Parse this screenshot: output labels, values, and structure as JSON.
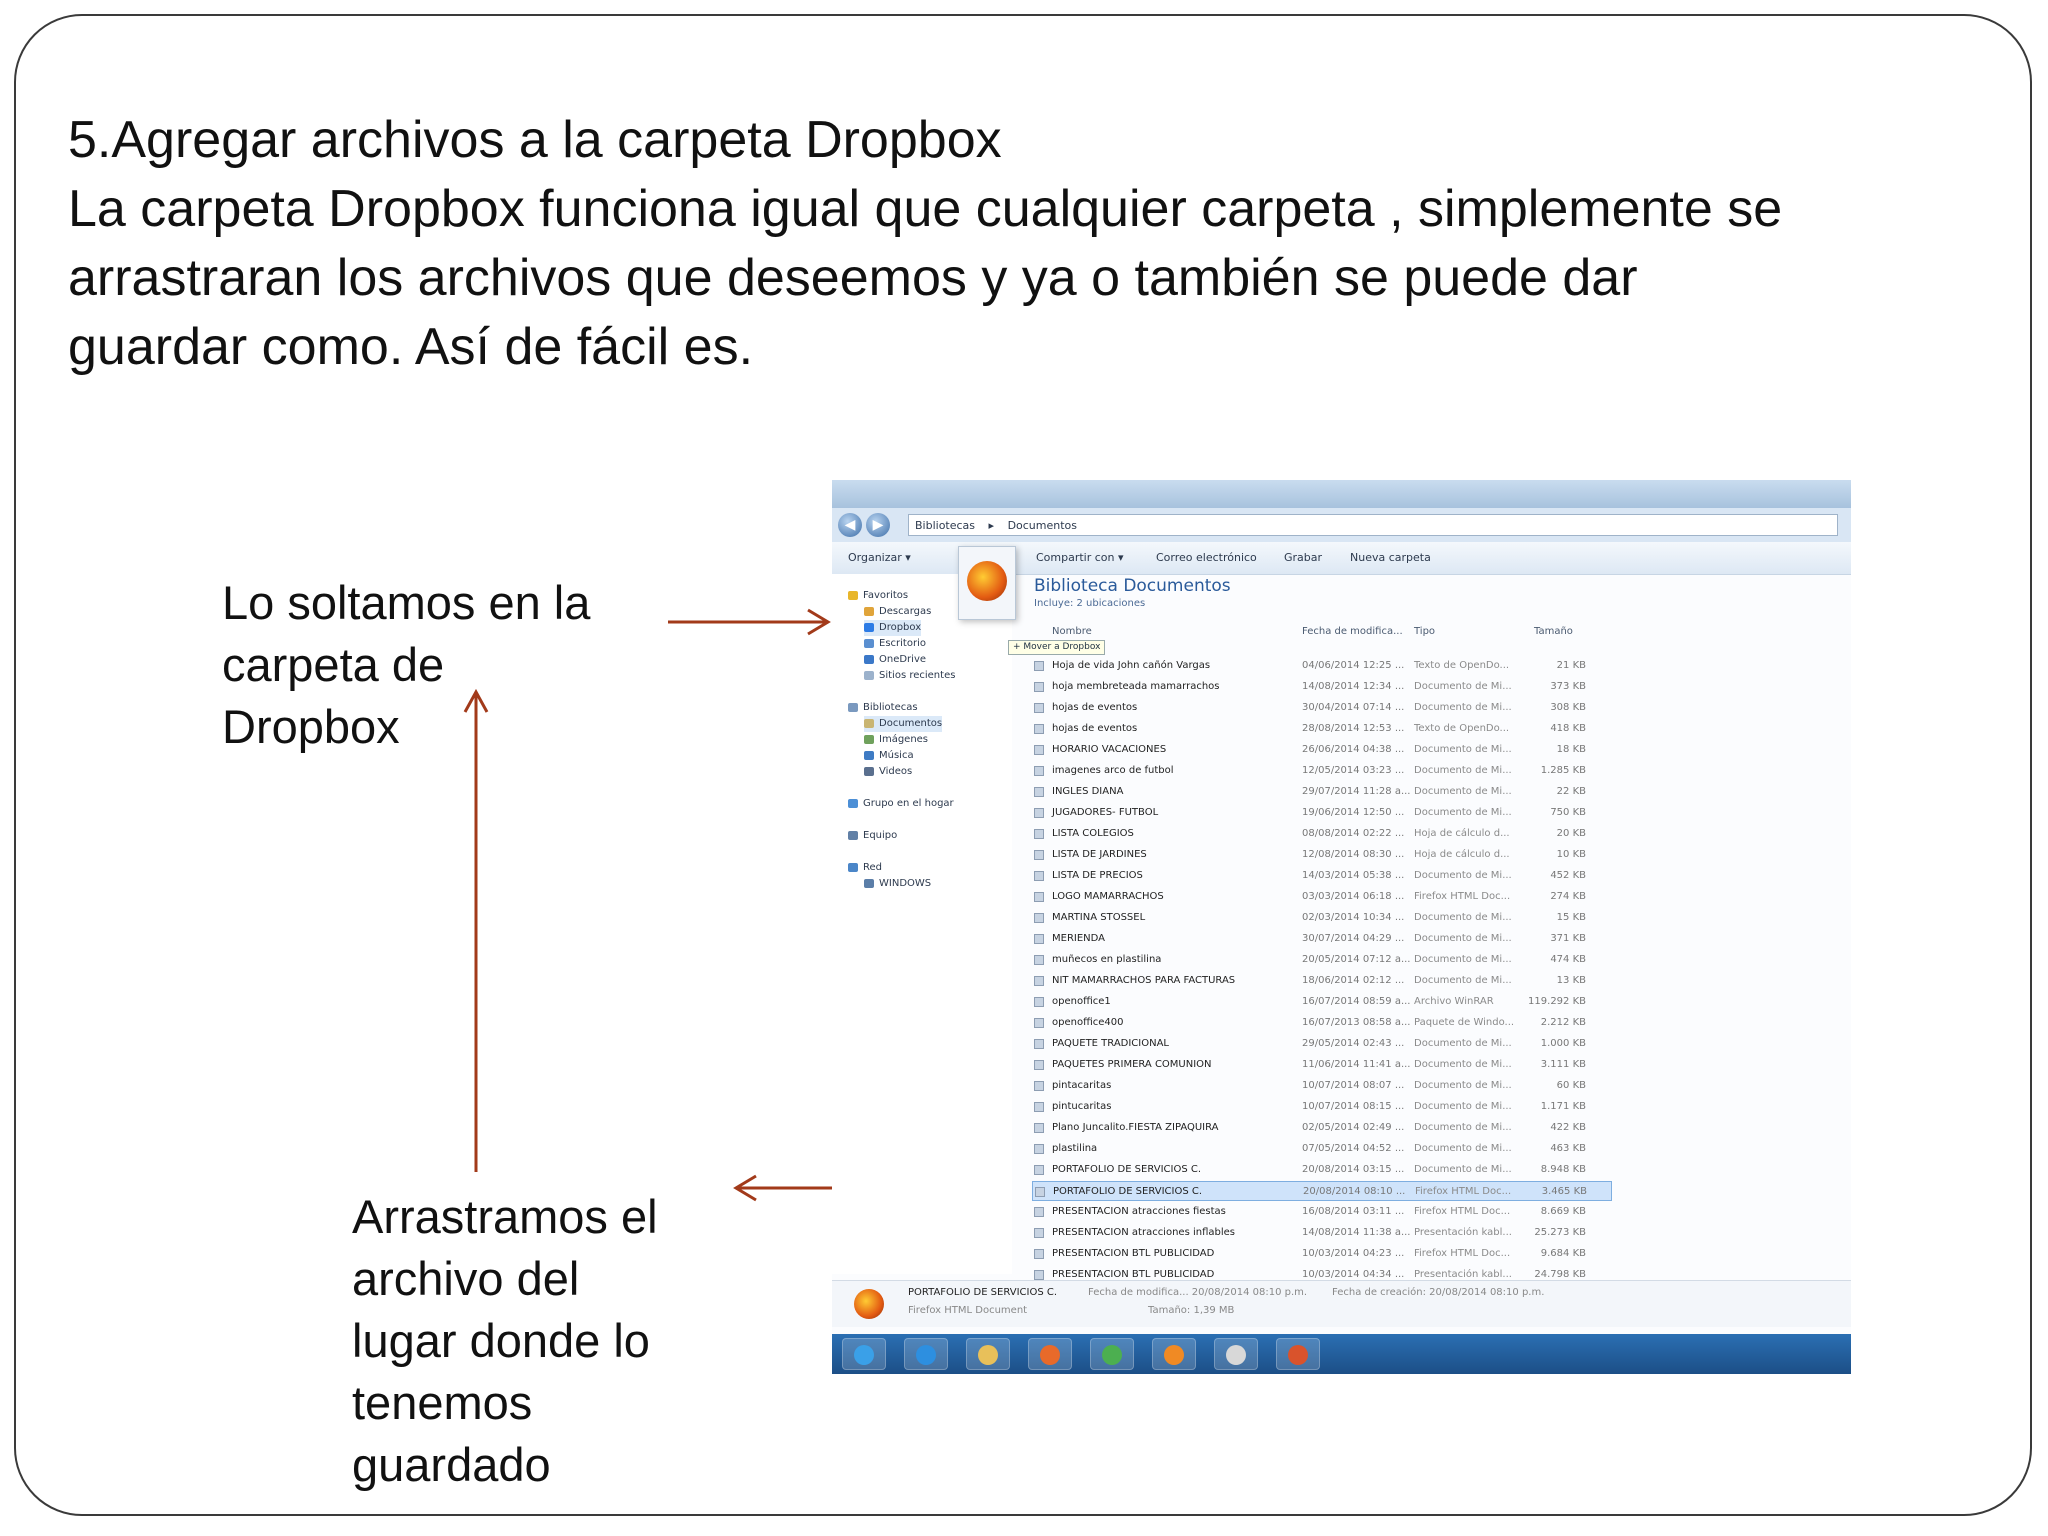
{
  "heading": {
    "line1": "5.Agregar archivos a la carpeta Dropbox",
    "line2": "La carpeta Dropbox funciona igual que cualquier carpeta , simplemente se",
    "line3": "arrastraran los archivos que deseemos  y ya o también se puede dar",
    "line4": "guardar como. Así de fácil es."
  },
  "callout_drop": [
    "Lo soltamos en la",
    "carpeta de",
    "Dropbox"
  ],
  "callout_drag": [
    "Arrastramos el",
    "archivo del",
    "lugar donde lo",
    "tenemos",
    "guardado"
  ],
  "arrow_color": "#a23a1a",
  "screenshot": {
    "breadcrumb": [
      "Bibliotecas",
      "Documentos"
    ],
    "toolbar": [
      "Organizar ▾",
      "Compartir con ▾",
      "Correo electrónico",
      "Grabar",
      "Nueva carpeta"
    ],
    "library_title": "Biblioteca Documentos",
    "library_subtitle": "Incluye: 2 ubicaciones",
    "drag_tooltip": "+ Mover a Dropbox",
    "nav": [
      {
        "label": "Favoritos",
        "icon": "star-icon"
      },
      {
        "label": "Descargas",
        "icon": "download-folder-icon"
      },
      {
        "label": "Dropbox",
        "icon": "dropbox-icon"
      },
      {
        "label": "Escritorio",
        "icon": "desktop-icon"
      },
      {
        "label": "OneDrive",
        "icon": "cloud-icon"
      },
      {
        "label": "Sitios recientes",
        "icon": "recent-icon"
      },
      {
        "label": "Bibliotecas",
        "icon": "library-icon"
      },
      {
        "label": "Documentos",
        "icon": "documents-icon"
      },
      {
        "label": "Imágenes",
        "icon": "images-icon"
      },
      {
        "label": "Música",
        "icon": "music-icon"
      },
      {
        "label": "Videos",
        "icon": "video-icon"
      },
      {
        "label": "Grupo en el hogar",
        "icon": "homegroup-icon"
      },
      {
        "label": "Equipo",
        "icon": "computer-icon"
      },
      {
        "label": "Red",
        "icon": "network-icon"
      },
      {
        "label": "WINDOWS",
        "icon": "pc-icon"
      }
    ],
    "columns": [
      "Nombre",
      "Fecha de modifica...",
      "Tipo",
      "Tamaño"
    ],
    "files": [
      {
        "name": "Hoja de vida John cañón Vargas",
        "date": "04/06/2014 12:25 ...",
        "type": "Texto de OpenDo...",
        "size": "21 KB"
      },
      {
        "name": "hoja membreteada mamarrachos",
        "date": "14/08/2014 12:34 ...",
        "type": "Documento de Mi...",
        "size": "373 KB"
      },
      {
        "name": "hojas de eventos",
        "date": "30/04/2014 07:14 ...",
        "type": "Documento de Mi...",
        "size": "308 KB"
      },
      {
        "name": "hojas de eventos",
        "date": "28/08/2014 12:53 ...",
        "type": "Texto de OpenDo...",
        "size": "418 KB"
      },
      {
        "name": "HORARIO VACACIONES",
        "date": "26/06/2014 04:38 ...",
        "type": "Documento de Mi...",
        "size": "18 KB"
      },
      {
        "name": "imagenes arco de futbol",
        "date": "12/05/2014 03:23 ...",
        "type": "Documento de Mi...",
        "size": "1.285 KB"
      },
      {
        "name": "INGLES DIANA",
        "date": "29/07/2014 11:28 a...",
        "type": "Documento de Mi...",
        "size": "22 KB"
      },
      {
        "name": "JUGADORES- FUTBOL",
        "date": "19/06/2014 12:50 ...",
        "type": "Documento de Mi...",
        "size": "750 KB"
      },
      {
        "name": "LISTA COLEGIOS",
        "date": "08/08/2014 02:22 ...",
        "type": "Hoja de cálculo d...",
        "size": "20 KB"
      },
      {
        "name": "LISTA DE JARDINES",
        "date": "12/08/2014 08:30 ...",
        "type": "Hoja de cálculo d...",
        "size": "10 KB"
      },
      {
        "name": "LISTA DE PRECIOS",
        "date": "14/03/2014 05:38 ...",
        "type": "Documento de Mi...",
        "size": "452 KB"
      },
      {
        "name": "LOGO MAMARRACHOS",
        "date": "03/03/2014 06:18 ...",
        "type": "Firefox HTML Doc...",
        "size": "274 KB"
      },
      {
        "name": "MARTINA STOSSEL",
        "date": "02/03/2014 10:34 ...",
        "type": "Documento de Mi...",
        "size": "15 KB"
      },
      {
        "name": "MERIENDA",
        "date": "30/07/2014 04:29 ...",
        "type": "Documento de Mi...",
        "size": "371 KB"
      },
      {
        "name": "muñecos en plastilina",
        "date": "20/05/2014 07:12 a...",
        "type": "Documento de Mi...",
        "size": "474 KB"
      },
      {
        "name": "NIT MAMARRACHOS PARA FACTURAS",
        "date": "18/06/2014 02:12 ...",
        "type": "Documento de Mi...",
        "size": "13 KB"
      },
      {
        "name": "openoffice1",
        "date": "16/07/2014 08:59 a...",
        "type": "Archivo WinRAR",
        "size": "119.292 KB"
      },
      {
        "name": "openoffice400",
        "date": "16/07/2013 08:58 a...",
        "type": "Paquete de Windo...",
        "size": "2.212 KB"
      },
      {
        "name": "PAQUETE TRADICIONAL",
        "date": "29/05/2014 02:43 ...",
        "type": "Documento de Mi...",
        "size": "1.000 KB"
      },
      {
        "name": "PAQUETES PRIMERA COMUNION",
        "date": "11/06/2014 11:41 a...",
        "type": "Documento de Mi...",
        "size": "3.111 KB"
      },
      {
        "name": "pintacaritas",
        "date": "10/07/2014 08:07 ...",
        "type": "Documento de Mi...",
        "size": "60 KB"
      },
      {
        "name": "pintucaritas",
        "date": "10/07/2014 08:15 ...",
        "type": "Documento de Mi...",
        "size": "1.171 KB"
      },
      {
        "name": "Plano Juncalito.FIESTA ZIPAQUIRA",
        "date": "02/05/2014 02:49 ...",
        "type": "Documento de Mi...",
        "size": "422 KB"
      },
      {
        "name": "plastilina",
        "date": "07/05/2014 04:52 ...",
        "type": "Documento de Mi...",
        "size": "463 KB"
      },
      {
        "name": "PORTAFOLIO DE SERVICIOS C.",
        "date": "20/08/2014 03:15 ...",
        "type": "Documento de Mi...",
        "size": "8.948 KB"
      },
      {
        "name": "PORTAFOLIO DE SERVICIOS C.",
        "date": "20/08/2014 08:10 ...",
        "type": "Firefox HTML Doc...",
        "size": "3.465 KB",
        "selected": true
      },
      {
        "name": "PRESENTACION atracciones fiestas",
        "date": "16/08/2014 03:11 ...",
        "type": "Firefox HTML Doc...",
        "size": "8.669 KB"
      },
      {
        "name": "PRESENTACION atracciones inflables",
        "date": "14/08/2014 11:38 a...",
        "type": "Presentación kabl...",
        "size": "25.273 KB"
      },
      {
        "name": "PRESENTACION BTL PUBLICIDAD",
        "date": "10/03/2014 04:23 ...",
        "type": "Firefox HTML Doc...",
        "size": "9.684 KB"
      },
      {
        "name": "PRESENTACION BTL PUBLICIDAD",
        "date": "10/03/2014 04:34 ...",
        "type": "Presentación kabl...",
        "size": "24.798 KB"
      }
    ],
    "details": {
      "name": "PORTAFOLIO DE SERVICIOS C.",
      "type": "Firefox HTML Document",
      "modified": "Fecha de modifica... 20/08/2014 08:10 p.m.",
      "size": "Tamaño: 1,39 MB",
      "created": "Fecha de creación: 20/08/2014 08:10 p.m."
    },
    "taskbar": [
      "start-orb-icon",
      "internet-explorer-icon",
      "explorer-folder-icon",
      "media-player-icon",
      "chrome-icon",
      "firefox-icon",
      "notepad-icon",
      "powerpoint-icon"
    ]
  }
}
